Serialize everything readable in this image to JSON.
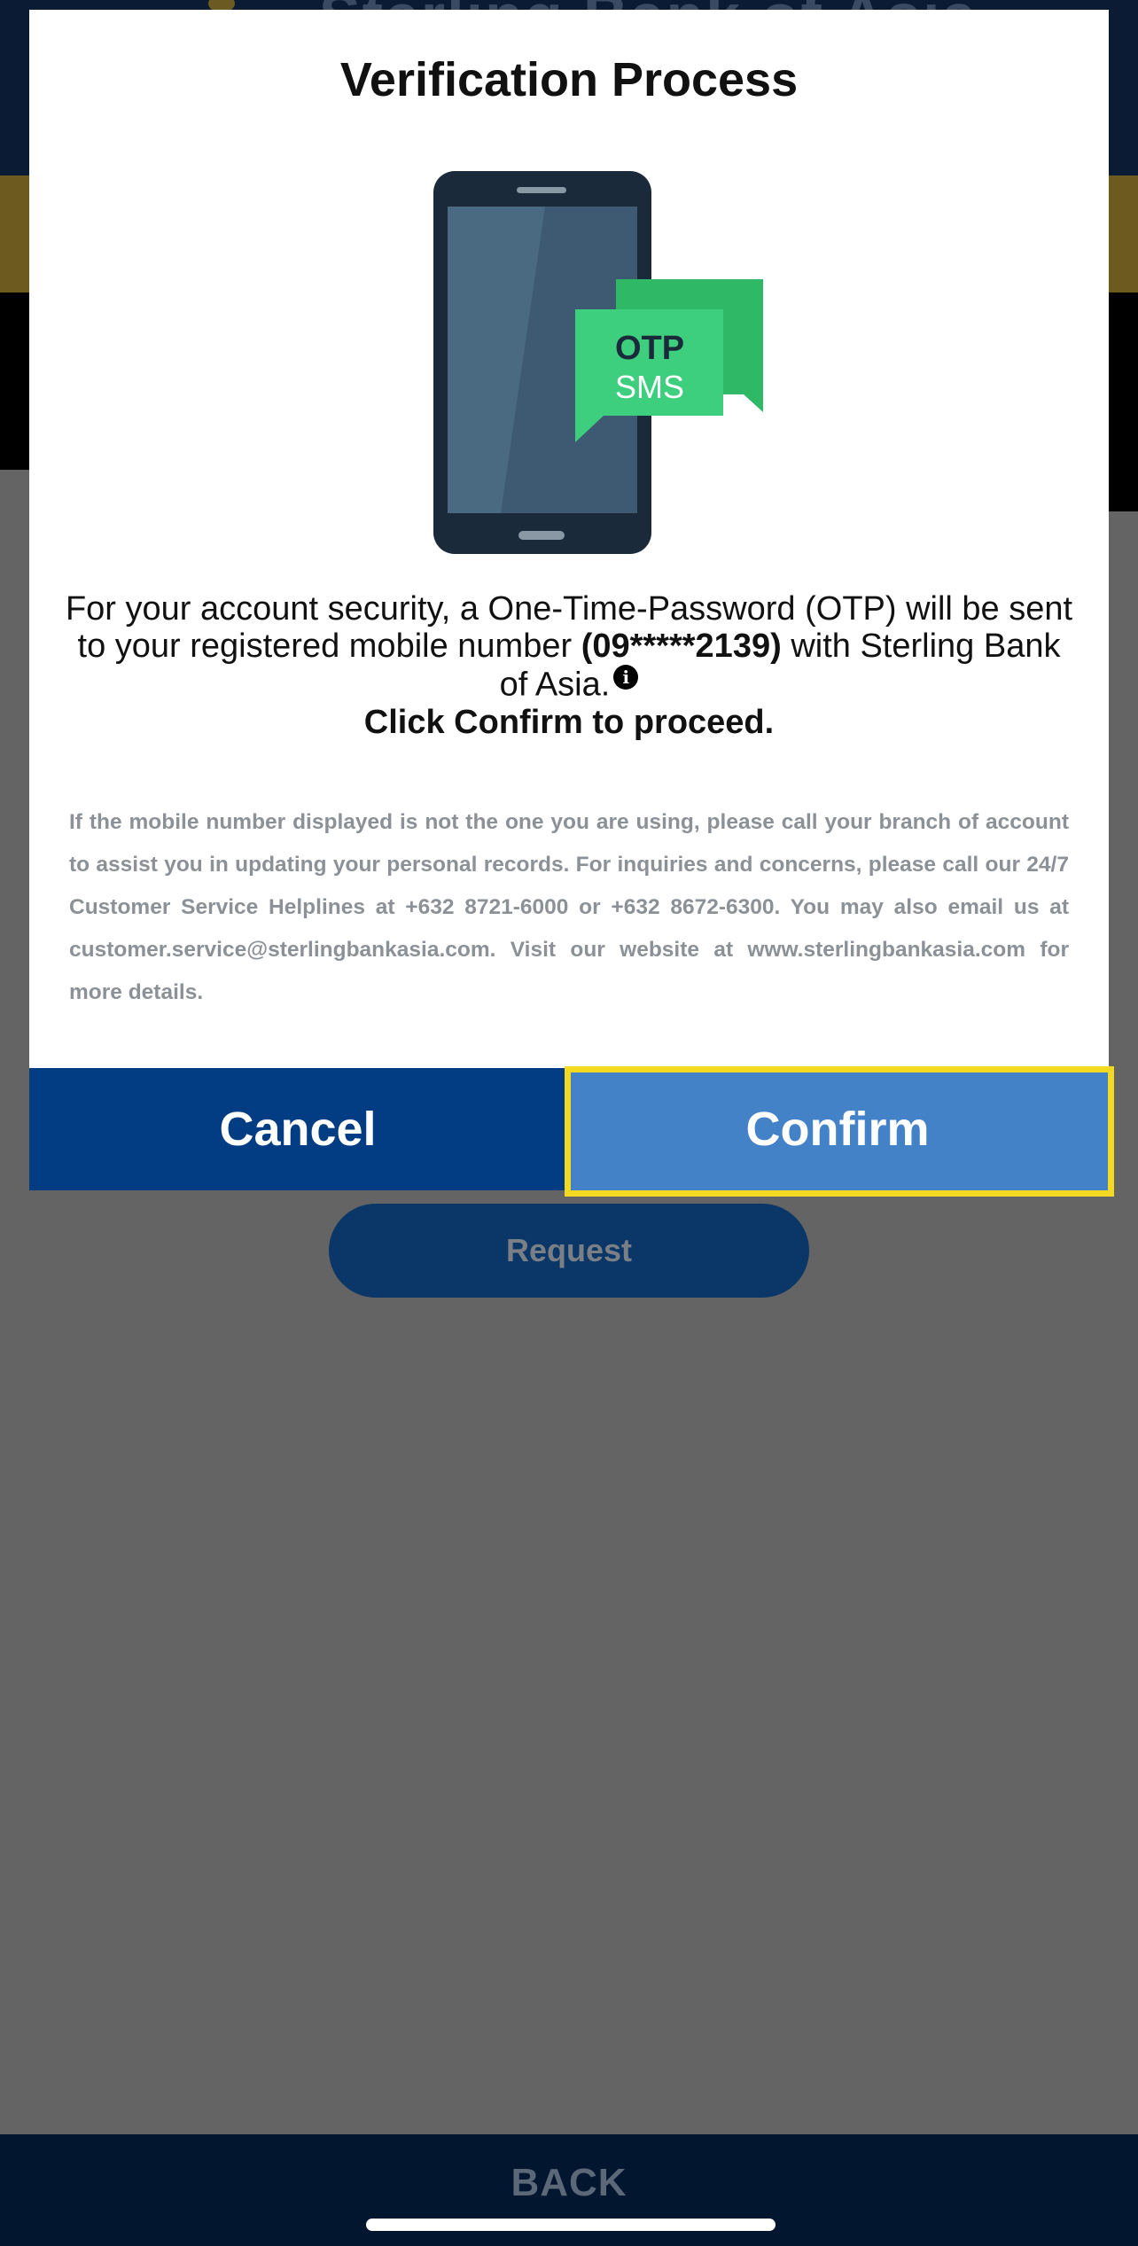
{
  "background": {
    "request_button_label": "Request",
    "back_label": "BACK"
  },
  "modal": {
    "title": "Verification Process",
    "illustration": {
      "bubble_line1": "OTP",
      "bubble_line2": "SMS",
      "icon": "phone-otp-sms-illustration"
    },
    "message": {
      "line1": "For your account security, a One-Time-Password (OTP) will be sent to your registered mobile number",
      "masked_number": "(09*****2139)",
      "line2": "with Sterling Bank of Asia.",
      "info_icon_glyph": "i",
      "proceed": "Click Confirm to proceed."
    },
    "disclaimer": "If the mobile number displayed is not the one you are using, please call your branch of account to assist you in updating your personal records. For inquiries and concerns, please call our 24/7 Customer Service Helplines at +632 8721-6000 or +632 8672-6300. You may also email us at customer.service@sterlingbankasia.com. Visit our website at www.sterlingbankasia.com for more details.",
    "cancel_label": "Cancel",
    "confirm_label": "Confirm"
  },
  "colors": {
    "cancel_bg": "#023c82",
    "confirm_bg": "#4482c8",
    "highlight": "#f4d923",
    "otp_green": "#2ecc71"
  }
}
